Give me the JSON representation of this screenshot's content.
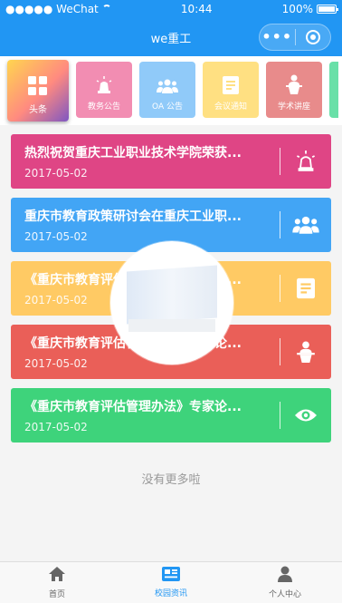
{
  "status": {
    "carrier": "●●●●● WeChat",
    "time": "10:44",
    "battery": "100%"
  },
  "navbar": {
    "title": "we重工",
    "more": "•••"
  },
  "colors": {
    "primary": "#2196f3",
    "card_pink": "#df4585",
    "card_blue": "#42a5f5",
    "card_yellow": "#ffca64",
    "card_red": "#ea5f58",
    "card_green": "#3ed37b"
  },
  "categories": [
    {
      "label": "头条",
      "icon": "grid-icon",
      "color": "",
      "active": true
    },
    {
      "label": "教务公告",
      "icon": "siren-icon",
      "color": "#f28db2",
      "active": false
    },
    {
      "label": "OA 公告",
      "icon": "group-icon",
      "color": "#90caf9",
      "active": false
    },
    {
      "label": "会议通知",
      "icon": "document-icon",
      "color": "#ffe082",
      "active": false
    },
    {
      "label": "学术讲座",
      "icon": "lecture-icon",
      "color": "#e88b8b",
      "active": false
    }
  ],
  "cards": [
    {
      "title": "热烈祝贺重庆工业职业技术学院荣获...",
      "date": "2017-05-02",
      "icon": "siren-icon"
    },
    {
      "title": "重庆市教育政策研讨会在重庆工业职...",
      "date": "2017-05-02",
      "icon": "group-icon"
    },
    {
      "title": "《重庆市教育评估管理办法》专家论...",
      "date": "2017-05-02",
      "icon": "document-icon"
    },
    {
      "title": "《重庆市教育评估管理办法》专家论...",
      "date": "2017-05-02",
      "icon": "lecture-icon"
    },
    {
      "title": "《重庆市教育评估管理办法》专家论...",
      "date": "2017-05-02",
      "icon": "eye-icon"
    }
  ],
  "no_more": "没有更多啦",
  "tabbar": [
    {
      "label": "首页",
      "icon": "home-icon",
      "active": false
    },
    {
      "label": "校园资讯",
      "icon": "news-icon",
      "active": true
    },
    {
      "label": "个人中心",
      "icon": "user-icon",
      "active": false
    }
  ]
}
